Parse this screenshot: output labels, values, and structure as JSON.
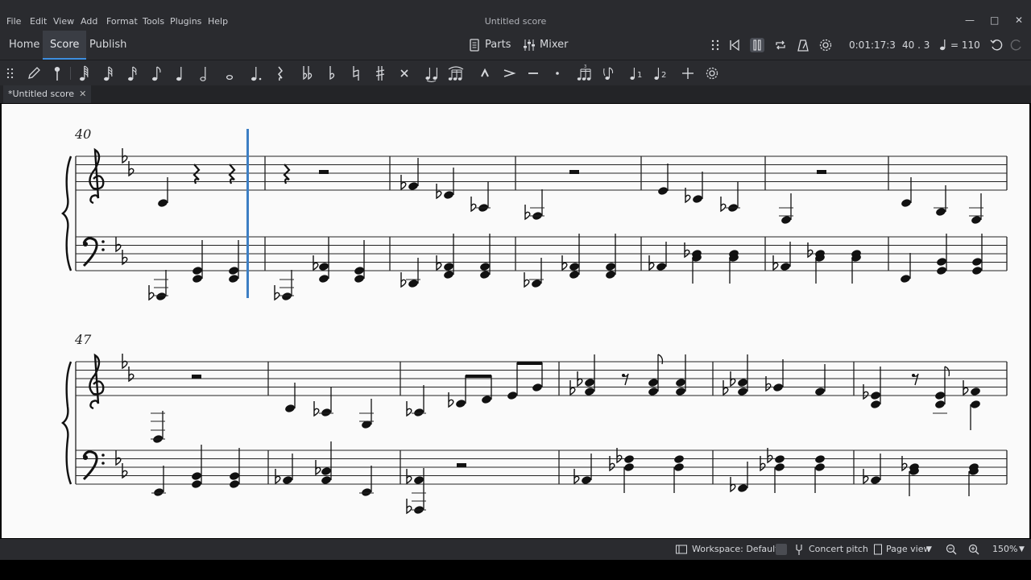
{
  "menu": {
    "items": [
      "File",
      "Edit",
      "View",
      "Add",
      "Format",
      "Tools",
      "Plugins",
      "Help"
    ],
    "title": "Untitled score"
  },
  "toolbar": {
    "tabs": [
      "Home",
      "Score",
      "Publish"
    ],
    "active_tab": "Score",
    "parts_label": "Parts",
    "mixer_label": "Mixer",
    "time": "0:01:17:3",
    "position": "40 . 3",
    "tempo": "= 110"
  },
  "note_input": {
    "buttons": [
      "pencil",
      "input-mode",
      "64th",
      "32nd",
      "16th",
      "eighth",
      "quarter",
      "half",
      "whole",
      "dot",
      "rest",
      "double-flat",
      "flat",
      "natural",
      "sharp",
      "double-sharp",
      "tie",
      "slur",
      "marcato",
      "accent",
      "tenuto",
      "staccato",
      "tuplet",
      "flip",
      "voice-1",
      "voice-2",
      "add",
      "customize"
    ]
  },
  "document": {
    "tab_label": "*Untitled score"
  },
  "score": {
    "system1_measure": "40",
    "system2_measure": "47",
    "key_signature": "B-flat major (2 flats)",
    "clefs": [
      "treble",
      "bass"
    ]
  },
  "status": {
    "workspace": "Workspace: Default",
    "concert_pitch": "Concert pitch",
    "view_mode": "Page view",
    "zoom": "150%"
  },
  "colors": {
    "chrome": "#2a2b2f",
    "accent": "#3d8fe0",
    "canvas": "#fafafa",
    "playback_cursor": "#3d7fc4"
  }
}
